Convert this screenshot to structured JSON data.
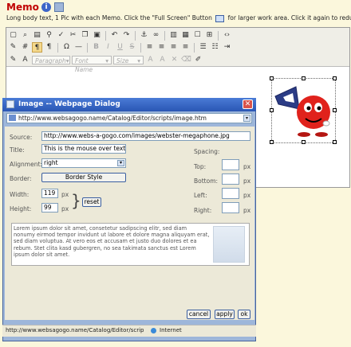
{
  "header": {
    "title": "Memo 1",
    "description": "Long body text, 1 Pic with each Memo. Click the \"Full Screen\" Button",
    "description_tail": "for larger work area. Click it again to reduce."
  },
  "toolbar": {
    "paragraph_placeholder": "Paragraph",
    "font_name_placeholder": "Font Name",
    "size_placeholder": "Size"
  },
  "dialog": {
    "title": "Image -- Webpage Dialog",
    "address": "http://www.websagogo.name/Catalog/Editor/scripts/image.htm",
    "source_label": "Source:",
    "source_value": "http://www.webs-a-gogo.com/images/webster-megaphone.jpg",
    "title_label": "Title:",
    "title_value": "This is the mouse over text",
    "alignment_label": "Alignment:",
    "alignment_value": "right",
    "border_label": "Border:",
    "border_button": "Border Style",
    "width_label": "Width:",
    "width_value": "119",
    "height_label": "Height:",
    "height_value": "99",
    "px": "px",
    "reset_button": "reset",
    "spacing_label": "Spacing:",
    "top_label": "Top:",
    "bottom_label": "Bottom:",
    "left_label": "Left:",
    "right_label": "Right:",
    "preview_text": "Lorem ipsum dolor sit amet, consetetur sadipscing elitr, sed diam nonumy eirmod tempor invidunt ut labore et dolore magna aliquyam erat, sed diam voluptua. At vero eos et accusam et justo duo dolores et ea rebum. Stet clita kasd gubergren, no sea takimata sanctus est Lorem ipsum dolor sit amet.",
    "cancel_button": "cancel",
    "apply_button": "apply",
    "ok_button": "ok",
    "status_url": "http://www.websagogo.name/Catalog/Editor/scrip",
    "status_zone": "Internet"
  },
  "colors": {
    "title_red": "#c00000",
    "dialog_blue": "#2a56b4",
    "active_button": "#f5d98c"
  }
}
